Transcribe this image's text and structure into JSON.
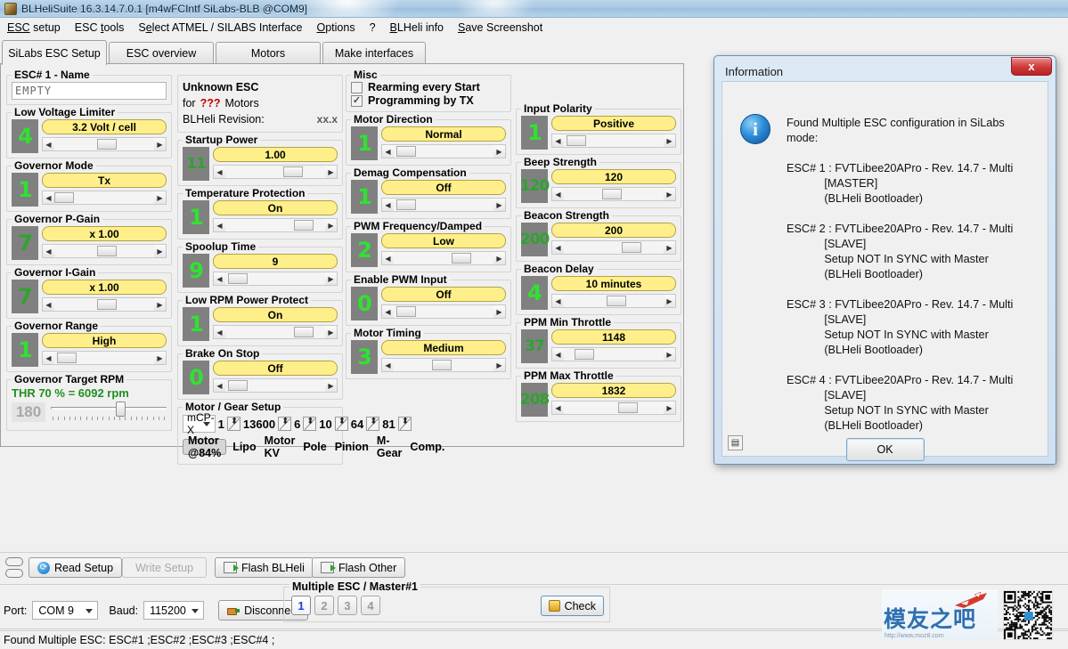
{
  "window": {
    "title": "BLHeliSuite 16.3.14.7.0.1  [m4wFCIntf SiLabs-BLB @COM9]",
    "icon": "app-icon"
  },
  "menu": [
    {
      "label": "ESC setup"
    },
    {
      "label": "ESC tools"
    },
    {
      "label": "Select ATMEL / SILABS Interface"
    },
    {
      "label": "Options"
    },
    {
      "label": "?"
    },
    {
      "label": "BLHeli info"
    },
    {
      "label": "Save Screenshot"
    }
  ],
  "tabs": [
    {
      "label": "SiLabs ESC Setup",
      "active": true
    },
    {
      "label": "ESC overview",
      "active": false
    },
    {
      "label": "Motors",
      "active": false
    },
    {
      "label": "Make interfaces",
      "active": false
    }
  ],
  "esc_name": {
    "group_label": "ESC# 1 - Name",
    "value": "EMPTY"
  },
  "esc_info": {
    "title": "Unknown ESC",
    "for_prefix": "for",
    "motors_unknown": "???",
    "for_suffix": "Motors",
    "revision_label": "BLHeli Revision:",
    "revision_value": "xx.x"
  },
  "misc": {
    "group_label": "Misc",
    "items": [
      {
        "label": "Rearming every Start",
        "checked": false,
        "mark": ""
      },
      {
        "label": "Programming by TX",
        "checked": true,
        "mark": "✓"
      }
    ]
  },
  "params": [
    {
      "col": 0,
      "label": "Low Voltage Limiter",
      "num": "4",
      "value": "3.2 Volt / cell",
      "thumb_pct": 46,
      "dim": false
    },
    {
      "col": 0,
      "label": "Governor Mode",
      "num": "1",
      "value": "Tx",
      "thumb_pct": 4,
      "dim": false
    },
    {
      "col": 0,
      "label": "Governor P-Gain",
      "num": "7",
      "value": "x 1.00",
      "thumb_pct": 46,
      "dim": true
    },
    {
      "col": 0,
      "label": "Governor I-Gain",
      "num": "7",
      "value": "x 1.00",
      "thumb_pct": 46,
      "dim": true
    },
    {
      "col": 0,
      "label": "Governor Range",
      "num": "1",
      "value": "High",
      "thumb_pct": 6,
      "dim": false
    },
    {
      "col": 1,
      "label": "Startup Power",
      "num": "11",
      "value": "1.00",
      "thumb_pct": 62,
      "dim": true
    },
    {
      "col": 1,
      "label": "Temperature Protection",
      "num": "1",
      "value": "On",
      "thumb_pct": 72,
      "dim": false
    },
    {
      "col": 1,
      "label": "Spoolup Time",
      "num": "9",
      "value": "9",
      "thumb_pct": 6,
      "dim": false
    },
    {
      "col": 1,
      "label": "Low RPM Power Protect",
      "num": "1",
      "value": "On",
      "thumb_pct": 72,
      "dim": false
    },
    {
      "col": 1,
      "label": "Brake On Stop",
      "num": "0",
      "value": "Off",
      "thumb_pct": 6,
      "dim": false
    },
    {
      "col": 2,
      "label": "Motor Direction",
      "num": "1",
      "value": "Normal",
      "thumb_pct": 6,
      "dim": false
    },
    {
      "col": 2,
      "label": "Demag Compensation",
      "num": "1",
      "value": "Off",
      "thumb_pct": 6,
      "dim": false
    },
    {
      "col": 2,
      "label": "PWM Frequency/Damped",
      "num": "2",
      "value": "Low",
      "thumb_pct": 62,
      "dim": false
    },
    {
      "col": 2,
      "label": "Enable PWM Input",
      "num": "0",
      "value": "Off",
      "thumb_pct": 6,
      "dim": false
    },
    {
      "col": 2,
      "label": "Motor Timing",
      "num": "3",
      "value": "Medium",
      "thumb_pct": 42,
      "dim": false
    },
    {
      "col": 3,
      "label": "Input Polarity",
      "num": "1",
      "value": "Positive",
      "thumb_pct": 6,
      "dim": false
    },
    {
      "col": 3,
      "label": "Beep Strength",
      "num": "120",
      "value": "120",
      "thumb_pct": 42,
      "dim": true
    },
    {
      "col": 3,
      "label": "Beacon Strength",
      "num": "200",
      "value": "200",
      "thumb_pct": 62,
      "dim": true
    },
    {
      "col": 3,
      "label": "Beacon Delay",
      "num": "4",
      "value": "10 minutes",
      "thumb_pct": 46,
      "dim": false
    },
    {
      "col": 3,
      "label": "PPM Min Throttle",
      "num": "37",
      "value": "1148",
      "thumb_pct": 14,
      "dim": true
    },
    {
      "col": 3,
      "label": "PPM Max Throttle",
      "num": "208",
      "value": "1832",
      "thumb_pct": 58,
      "dim": true
    }
  ],
  "governor_target_rpm": {
    "group_label": "Governor Target RPM",
    "thr_line": "THR 70 % = 6092 rpm",
    "value": "180",
    "slider_pct": 56
  },
  "motor_gear_setup": {
    "group_label": "Motor / Gear Setup",
    "model": "mCP-X",
    "fields": [
      {
        "value": "1",
        "label": "Lipo"
      },
      {
        "value": "13600",
        "label": "Motor KV"
      },
      {
        "value": "6",
        "label": "Pole"
      },
      {
        "value": "10",
        "label": "Pinion"
      },
      {
        "value": "64",
        "label": "M-Gear"
      },
      {
        "value": "81",
        "label": "Comp."
      }
    ],
    "motor_button": "Motor @84%"
  },
  "dialog": {
    "title": "Information",
    "close_label": "x",
    "icon": "info-icon",
    "icon_glyph": "i",
    "message": "Found Multiple ESC configuration in SiLabs mode:\n\nESC# 1 : FVTLibee20APro - Rev. 14.7 - Multi\n            [MASTER]\n            (BLHeli Bootloader)\n\nESC# 2 : FVTLibee20APro - Rev. 14.7 - Multi\n            [SLAVE]\n            Setup NOT In SYNC with Master\n            (BLHeli Bootloader)\n\nESC# 3 : FVTLibee20APro - Rev. 14.7 - Multi\n            [SLAVE]\n            Setup NOT In SYNC with Master\n            (BLHeli Bootloader)\n\nESC# 4 : FVTLibee20APro - Rev. 14.7 - Multi\n            [SLAVE]\n            Setup NOT In SYNC with Master\n            (BLHeli Bootloader)",
    "ok_label": "OK",
    "corner_icon": "resize-grip-icon"
  },
  "toolbar": {
    "read_setup": "Read Setup",
    "write_setup": "Write Setup",
    "flash_blheli": "Flash BLHeli",
    "flash_other": "Flash Other"
  },
  "connection": {
    "port_label": "Port:",
    "port_value": "COM 9",
    "baud_label": "Baud:",
    "baud_value": "115200",
    "disconnect_label": "Disconnect"
  },
  "multiple_esc": {
    "group_label": "Multiple ESC / Master#1",
    "buttons": [
      {
        "label": "1",
        "selected": true
      },
      {
        "label": "2",
        "selected": false
      },
      {
        "label": "3",
        "selected": false
      },
      {
        "label": "4",
        "selected": false
      }
    ],
    "check_label": "Check"
  },
  "status": {
    "text": "Found Multiple ESC: ESC#1 ;ESC#2 ;ESC#3 ;ESC#4 ;"
  },
  "watermark": {
    "text_cn": "模友之吧",
    "url": "http://www.moz8.com"
  },
  "colors": {
    "accent_yellow": "#ffef8a",
    "green_number": "#31e131",
    "gray_numbox": "#808080",
    "titlebar": "#a8c8e2",
    "dialog_border": "#6a91b5",
    "close_red": "#cf3c3c"
  }
}
